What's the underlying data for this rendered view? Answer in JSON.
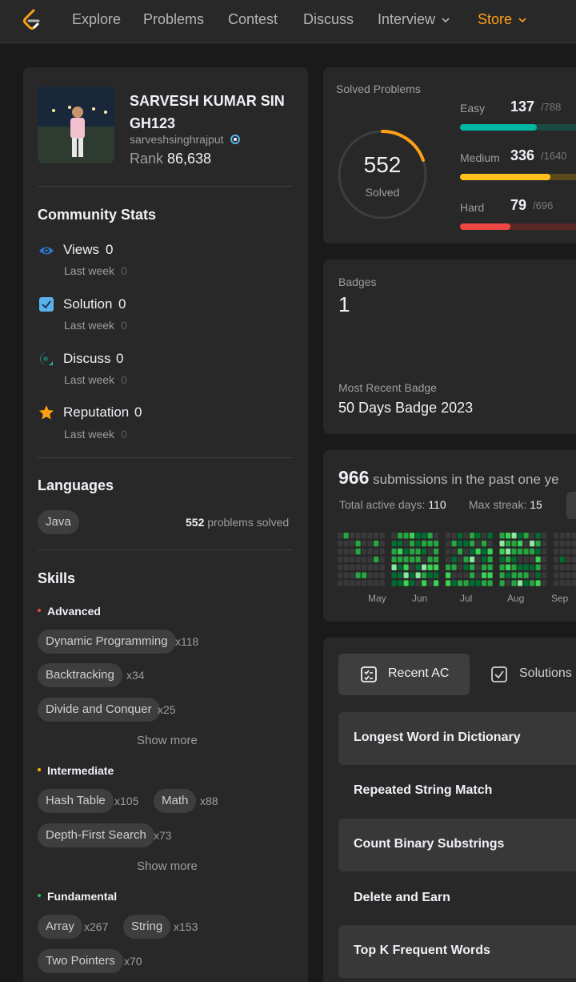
{
  "nav": {
    "items": [
      {
        "label": "Explore"
      },
      {
        "label": "Problems"
      },
      {
        "label": "Contest"
      },
      {
        "label": "Discuss"
      },
      {
        "label": "Interview"
      },
      {
        "label": "Store"
      }
    ],
    "accent_color": "#ffa116"
  },
  "profile": {
    "name": "SARVESH KUMAR SIN GH123",
    "username": "sarveshsinghrajput",
    "rank_label": "Rank",
    "rank_value": "86,638"
  },
  "community": {
    "title": "Community Stats",
    "stats": [
      {
        "label": "Views",
        "value": "0",
        "sub_label": "Last week",
        "sub_value": "0",
        "icon": "eye-icon",
        "color": "#2e7bd6"
      },
      {
        "label": "Solution",
        "value": "0",
        "sub_label": "Last week",
        "sub_value": "0",
        "icon": "solution-icon",
        "color": "#5ab2ea"
      },
      {
        "label": "Discuss",
        "value": "0",
        "sub_label": "Last week",
        "sub_value": "0",
        "icon": "discuss-icon",
        "color": "#27b5a4"
      },
      {
        "label": "Reputation",
        "value": "0",
        "sub_label": "Last week",
        "sub_value": "0",
        "icon": "star-icon",
        "color": "#ffa116"
      }
    ]
  },
  "languages": {
    "title": "Languages",
    "items": [
      {
        "name": "Java",
        "count": "552",
        "suffix": "problems solved"
      }
    ]
  },
  "skills": {
    "title": "Skills",
    "show_more": "Show more",
    "groups": [
      {
        "level": "Advanced",
        "color": "#ef4743",
        "tags": [
          {
            "name": "Dynamic Programming",
            "count": "x118"
          },
          {
            "name": "Backtracking",
            "count": "x34"
          },
          {
            "name": "Divide and Conquer",
            "count": "x25"
          }
        ]
      },
      {
        "level": "Intermediate",
        "color": "#ffb800",
        "tags": [
          {
            "name": "Hash Table",
            "count": "x105"
          },
          {
            "name": "Math",
            "count": "x88"
          },
          {
            "name": "Depth-First Search",
            "count": "x73"
          }
        ]
      },
      {
        "level": "Fundamental",
        "color": "#2cbb5d",
        "tags": [
          {
            "name": "Array",
            "count": "x267"
          },
          {
            "name": "String",
            "count": "x153"
          },
          {
            "name": "Two Pointers",
            "count": "x70"
          }
        ]
      }
    ]
  },
  "solved": {
    "title": "Solved Problems",
    "total": "552",
    "total_label": "Solved",
    "difficulties": [
      {
        "label": "Easy",
        "solved": "137",
        "total": "/788",
        "fraction": 0.174,
        "color": "#00b8a3",
        "track": "#1a4a44"
      },
      {
        "label": "Medium",
        "solved": "336",
        "total": "/1640",
        "fraction": 0.205,
        "color": "#ffc01e",
        "track": "#5a4a1a"
      },
      {
        "label": "Hard",
        "solved": "79",
        "total": "/696",
        "fraction": 0.114,
        "color": "#ef4743",
        "track": "#5a2626"
      }
    ]
  },
  "badges": {
    "title": "Badges",
    "count": "1",
    "recent_label": "Most Recent Badge",
    "recent_name": "50 Days Badge 2023"
  },
  "submissions": {
    "count": "966",
    "text": "submissions in the past one ye",
    "active_label": "Total active days:",
    "active_value": "110",
    "streak_label": "Max streak:",
    "streak_value": "15",
    "months": [
      "May",
      "Jun",
      "Jul",
      "Aug",
      "Sep"
    ]
  },
  "recent": {
    "tabs": [
      {
        "label": "Recent AC",
        "icon": "list-icon"
      },
      {
        "label": "Solutions",
        "icon": "check-box-icon"
      }
    ],
    "items": [
      {
        "title": "Longest Word in Dictionary"
      },
      {
        "title": "Repeated String Match"
      },
      {
        "title": "Count Binary Substrings"
      },
      {
        "title": "Delete and Earn"
      },
      {
        "title": "Top K Frequent Words"
      }
    ]
  }
}
